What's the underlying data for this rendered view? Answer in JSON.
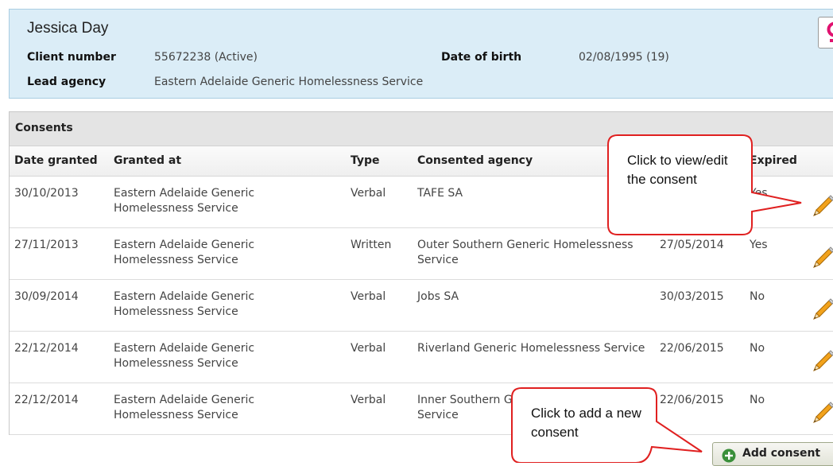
{
  "client": {
    "name": "Jessica Day",
    "client_number_label": "Client number",
    "client_number": "55672238 (Active)",
    "dob_label": "Date of birth",
    "dob": "02/08/1995 (19)",
    "lead_agency_label": "Lead agency",
    "lead_agency": "Eastern Adelaide Generic Homelessness Service",
    "gender_icon": "female-symbol-icon",
    "gender_color": "#e0116f"
  },
  "consents": {
    "title": "Consents",
    "columns": {
      "date_granted": "Date granted",
      "granted_at": "Granted at",
      "type": "Type",
      "consented_agency": "Consented agency",
      "expired": "Expired"
    },
    "rows": [
      {
        "date_granted": "30/10/2013",
        "granted_at": "Eastern Adelaide Generic Homelessness Service",
        "type": "Verbal",
        "agency": "TAFE SA",
        "expiry": "",
        "expired": "Yes"
      },
      {
        "date_granted": "27/11/2013",
        "granted_at": "Eastern Adelaide Generic Homelessness Service",
        "type": "Written",
        "agency": "Outer Southern Generic Homelessness Service",
        "expiry": "27/05/2014",
        "expired": "Yes"
      },
      {
        "date_granted": "30/09/2014",
        "granted_at": "Eastern Adelaide Generic Homelessness Service",
        "type": "Verbal",
        "agency": "Jobs SA",
        "expiry": "30/03/2015",
        "expired": "No"
      },
      {
        "date_granted": "22/12/2014",
        "granted_at": "Eastern Adelaide Generic Homelessness Service",
        "type": "Verbal",
        "agency": "Riverland Generic Homelessness Service",
        "expiry": "22/06/2015",
        "expired": "No"
      },
      {
        "date_granted": "22/12/2014",
        "granted_at": "Eastern Adelaide Generic Homelessness Service",
        "type": "Verbal",
        "agency": "Inner Southern Generic Homelessness Service",
        "expiry": "22/06/2015",
        "expired": "No"
      }
    ],
    "edit_icon": "pencil-icon",
    "add_button_label": "Add consent",
    "add_icon": "plus-circle-icon"
  },
  "callouts": {
    "edit": "Click to view/edit the consent",
    "add": "Click to add a new consent",
    "border_color": "#e02020"
  }
}
